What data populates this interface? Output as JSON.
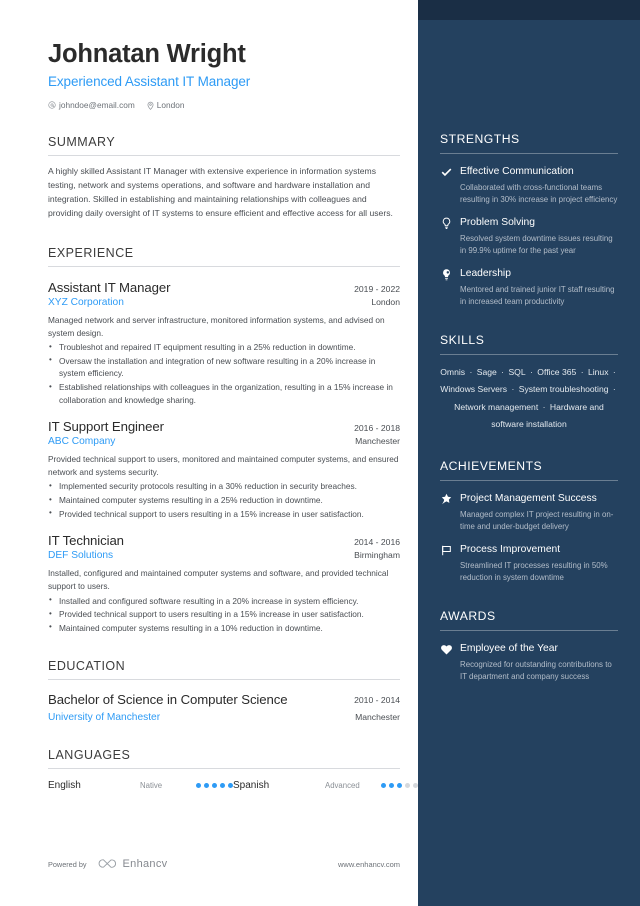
{
  "header": {
    "name": "Johnatan Wright",
    "headline": "Experienced Assistant IT Manager",
    "email": "johndoe@email.com",
    "location": "London"
  },
  "summary": {
    "title": "SUMMARY",
    "text": "A highly skilled Assistant IT Manager with extensive experience in information systems testing, network and systems operations, and software and hardware installation and integration. Skilled in establishing and maintaining relationships with colleagues and providing daily oversight of IT systems to ensure efficient and effective access for all users."
  },
  "experience": {
    "title": "EXPERIENCE",
    "jobs": [
      {
        "title": "Assistant IT Manager",
        "date": "2019 - 2022",
        "company": "XYZ Corporation",
        "location": "London",
        "description": "Managed network and server infrastructure, monitored information systems, and advised on system design.",
        "bullets": [
          "Troubleshot and repaired IT equipment resulting in a 25% reduction in downtime.",
          "Oversaw the installation and integration of new software resulting in a 20% increase in system efficiency.",
          "Established relationships with colleagues in the organization, resulting in a 15% increase in collaboration and knowledge sharing."
        ]
      },
      {
        "title": "IT Support Engineer",
        "date": "2016 - 2018",
        "company": "ABC Company",
        "location": "Manchester",
        "description": "Provided technical support to users, monitored and maintained computer systems, and ensured network and systems security.",
        "bullets": [
          "Implemented security protocols resulting in a 30% reduction in security breaches.",
          "Maintained computer systems resulting in a 25% reduction in downtime.",
          "Provided technical support to users resulting in a 15% increase in user satisfaction."
        ]
      },
      {
        "title": "IT Technician",
        "date": "2014 - 2016",
        "company": "DEF Solutions",
        "location": "Birmingham",
        "description": "Installed, configured and maintained computer systems and software, and provided technical support to users.",
        "bullets": [
          "Installed and configured software resulting in a 20% increase in system efficiency.",
          "Provided technical support to users resulting in a 15% increase in user satisfaction.",
          "Maintained computer systems resulting in a 10% reduction in downtime."
        ]
      }
    ]
  },
  "education": {
    "title": "EDUCATION",
    "entries": [
      {
        "degree": "Bachelor of Science in Computer Science",
        "date": "2010 - 2014",
        "school": "University of Manchester",
        "location": "Manchester"
      }
    ]
  },
  "languages": {
    "title": "LANGUAGES",
    "items": [
      {
        "name": "English",
        "level": "Native",
        "filled": 5,
        "total": 5
      },
      {
        "name": "Spanish",
        "level": "Advanced",
        "filled": 3,
        "total": 5
      }
    ]
  },
  "footer": {
    "powered_by": "Powered by",
    "brand": "Enhancv",
    "url": "www.enhancv.com"
  },
  "strengths": {
    "title": "STRENGTHS",
    "items": [
      {
        "icon": "check-icon",
        "title": "Effective Communication",
        "desc": "Collaborated with cross-functional teams resulting in 30% increase in project efficiency"
      },
      {
        "icon": "lightbulb-icon",
        "title": "Problem Solving",
        "desc": "Resolved system downtime issues resulting in 99.9% uptime for the past year"
      },
      {
        "icon": "leadership-icon",
        "title": "Leadership",
        "desc": "Mentored and trained junior IT staff resulting in increased team productivity"
      }
    ]
  },
  "skills": {
    "title": "SKILLS",
    "items": [
      "Omnis",
      "Sage",
      "SQL",
      "Office 365",
      "Linux",
      "Windows Servers",
      "System troubleshooting",
      "Network management",
      "Hardware and software installation"
    ]
  },
  "achievements": {
    "title": "ACHIEVEMENTS",
    "items": [
      {
        "icon": "star-icon",
        "title": "Project Management Success",
        "desc": "Managed complex IT project resulting in on-time and under-budget delivery"
      },
      {
        "icon": "flag-icon",
        "title": "Process Improvement",
        "desc": "Streamlined IT processes resulting in 50% reduction in system downtime"
      }
    ]
  },
  "awards": {
    "title": "AWARDS",
    "items": [
      {
        "icon": "heart-icon",
        "title": "Employee of the Year",
        "desc": "Recognized for outstanding contributions to IT department and company success"
      }
    ]
  },
  "colors": {
    "accent_blue": "#2e9bf5",
    "sidebar_navy": "#24415f",
    "sidebar_top_band": "#1a2e45",
    "text_dark": "#2b2b2b"
  }
}
